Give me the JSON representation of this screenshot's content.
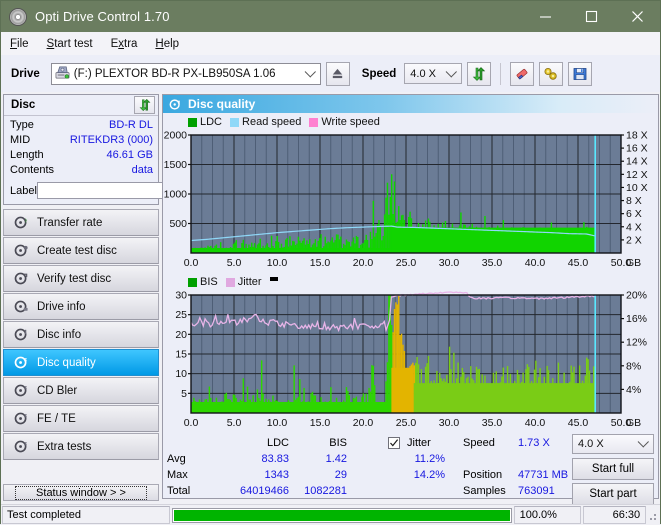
{
  "window": {
    "title": "Opti Drive Control 1.70",
    "icon": "disc-icon",
    "minimize": "minimize",
    "maximize": "maximize",
    "close": "close"
  },
  "menu": [
    {
      "label": "File",
      "accel": "F"
    },
    {
      "label": "Start test",
      "accel": "S"
    },
    {
      "label": "Extra",
      "accel": "x"
    },
    {
      "label": "Help",
      "accel": "H"
    }
  ],
  "toolbar": {
    "drive_label": "Drive",
    "drive_value": "(F:)  PLEXTOR BD-R  PX-LB950SA 1.06",
    "eject_icon": "eject-icon",
    "speed_label": "Speed",
    "speed_value": "4.0 X",
    "refresh_icon": "refresh-icon",
    "erase_icon": "eraser-icon",
    "settings_icon": "tools-icon",
    "save_icon": "floppy-save-icon"
  },
  "disc_panel": {
    "title": "Disc",
    "refresh_icon": "refresh-icon",
    "rows": [
      {
        "key": "Type",
        "value": "BD-R DL"
      },
      {
        "key": "MID",
        "value": "RITEKDR3 (000)"
      },
      {
        "key": "Length",
        "value": "46.61 GB"
      },
      {
        "key": "Contents",
        "value": "data"
      }
    ],
    "label_key": "Label",
    "label_value": "",
    "label_placeholder": "",
    "label_button_icon": "cd-icon"
  },
  "nav": [
    {
      "label": "Transfer rate",
      "icon": "disc-speed-icon",
      "selected": false
    },
    {
      "label": "Create test disc",
      "icon": "disc-write-icon",
      "selected": false
    },
    {
      "label": "Verify test disc",
      "icon": "disc-verify-icon",
      "selected": false
    },
    {
      "label": "Drive info",
      "icon": "drive-info-icon",
      "selected": false
    },
    {
      "label": "Disc info",
      "icon": "disc-info-icon",
      "selected": false
    },
    {
      "label": "Disc quality",
      "icon": "disc-quality-icon",
      "selected": true
    },
    {
      "label": "CD Bler",
      "icon": "cd-bler-icon",
      "selected": false
    },
    {
      "label": "FE / TE",
      "icon": "fete-icon",
      "selected": false
    },
    {
      "label": "Extra tests",
      "icon": "extra-tests-icon",
      "selected": false
    }
  ],
  "status_window_button": "Status window > >",
  "panel": {
    "title": "Disc quality",
    "icon": "disc-quality-icon"
  },
  "chart_data": [
    {
      "type": "area",
      "title": "LDC / Read speed",
      "legend": [
        {
          "label": "LDC",
          "color": "#00A000"
        },
        {
          "label": "Read speed",
          "color": "#8FD8F8"
        },
        {
          "label": "Write speed",
          "color": "#FF80D0"
        }
      ],
      "legend_position": "top-left",
      "xlabel": "GB",
      "xlim": [
        0,
        50
      ],
      "xticks": [
        "0.0",
        "5.0",
        "10.0",
        "15.0",
        "20.0",
        "25.0",
        "30.0",
        "35.0",
        "40.0",
        "45.0",
        "50.0"
      ],
      "ylabel_left": "LDC",
      "ylim": [
        0,
        2000
      ],
      "yticks": [
        "500",
        "1000",
        "1500",
        "2000"
      ],
      "ylabel_right": "Speed",
      "ylim_right": [
        0,
        18
      ],
      "yticks_right": [
        "2 X",
        "4 X",
        "6 X",
        "8 X",
        "10 X",
        "12 X",
        "14 X",
        "16 X",
        "18 X"
      ],
      "grid": true,
      "plot_bg": "#6B7C96",
      "series": [
        {
          "name": "LDC",
          "color": "#00D000",
          "x": [
            0.0,
            0.5,
            1.0,
            1.5,
            2.0,
            2.5,
            3.0,
            3.5,
            4.0,
            4.5,
            5.0,
            5.5,
            6.0,
            6.5,
            7.0,
            7.5,
            8.0,
            8.5,
            9.0,
            9.5,
            10.0,
            10.5,
            11.0,
            11.5,
            12.0,
            12.5,
            13.0,
            13.5,
            14.0,
            14.5,
            15.0,
            15.5,
            16.0,
            16.5,
            17.0,
            17.5,
            18.0,
            18.5,
            19.0,
            19.5,
            20.0,
            20.5,
            21.0,
            21.5,
            22.0,
            22.5,
            23.0,
            23.2,
            23.4,
            23.6,
            23.8,
            24.0,
            24.2,
            24.4,
            24.6,
            24.8,
            25.0,
            25.2,
            25.5,
            26.0,
            26.5,
            27.0,
            27.5,
            28.0,
            28.5,
            29.0,
            29.5,
            30.0,
            30.5,
            31.0,
            31.5,
            32.0,
            32.5,
            33.0,
            33.5,
            34.0,
            34.5,
            35.0,
            35.5,
            36.0,
            36.5,
            37.0,
            37.5,
            38.0,
            38.5,
            39.0,
            39.5,
            40.0,
            40.5,
            41.0,
            41.5,
            42.0,
            42.5,
            43.0,
            43.5,
            44.0,
            44.5,
            45.0,
            45.5,
            46.0,
            46.5,
            47.0
          ],
          "y": [
            60,
            70,
            90,
            60,
            110,
            70,
            120,
            80,
            140,
            75,
            130,
            65,
            150,
            80,
            160,
            90,
            200,
            100,
            185,
            95,
            210,
            110,
            190,
            120,
            230,
            130,
            215,
            140,
            250,
            135,
            240,
            150,
            260,
            145,
            255,
            160,
            245,
            155,
            280,
            165,
            300,
            175,
            320,
            340,
            420,
            600,
            1343,
            980,
            900,
            1100,
            760,
            880,
            700,
            1060,
            620,
            540,
            500,
            470,
            430,
            410,
            395,
            380,
            420,
            360,
            390,
            350,
            370,
            345,
            360,
            330,
            355,
            325,
            350,
            320,
            345,
            315,
            340,
            310,
            335,
            305,
            330,
            300,
            325,
            295,
            320,
            290,
            315,
            285,
            310,
            280,
            305,
            275,
            300,
            270,
            295,
            265,
            290,
            260,
            285,
            255
          ]
        },
        {
          "name": "Read speed",
          "color": "#8FD8F8",
          "x": [
            0.0,
            2.0,
            4.0,
            6.0,
            8.0,
            10.0,
            12.0,
            14.0,
            16.0,
            18.0,
            20.0,
            22.0,
            23.3,
            24.0,
            26.0,
            28.0,
            30.0,
            32.0,
            34.0,
            36.0,
            38.0,
            40.0,
            42.0,
            44.0,
            46.0,
            47.0
          ],
          "y": [
            1.9,
            2.1,
            2.35,
            2.6,
            2.85,
            3.1,
            3.3,
            3.5,
            3.7,
            3.85,
            3.95,
            4.05,
            4.1,
            3.95,
            3.9,
            3.8,
            3.7,
            3.6,
            3.5,
            3.4,
            3.3,
            3.2,
            3.1,
            2.95,
            2.9,
            2.6
          ]
        }
      ],
      "cursor_x": 47.0,
      "cursor_color": "#59E8FF"
    },
    {
      "type": "area",
      "title": "BIS / Jitter",
      "legend": [
        {
          "label": "BIS",
          "color": "#00A000"
        },
        {
          "label": "Jitter",
          "color": "#E0A8E0"
        },
        {
          "label": "",
          "color": "#000000"
        }
      ],
      "legend_position": "top-left",
      "xlabel": "GB",
      "xlim": [
        0,
        50
      ],
      "xticks": [
        "0.0",
        "5.0",
        "10.0",
        "15.0",
        "20.0",
        "25.0",
        "30.0",
        "35.0",
        "40.0",
        "45.0",
        "50.0"
      ],
      "ylabel_left": "BIS",
      "ylim": [
        0,
        30
      ],
      "yticks": [
        "5",
        "10",
        "15",
        "20",
        "25",
        "30"
      ],
      "ylabel_right": "Jitter",
      "ylim_right": [
        0,
        20
      ],
      "yticks_right": [
        "4%",
        "8%",
        "12%",
        "16%",
        "20%"
      ],
      "grid": true,
      "plot_bg": "#6B7C96",
      "series": [
        {
          "name": "BIS",
          "color": "#44D000",
          "x": [
            0.0,
            0.5,
            1.0,
            1.5,
            2.0,
            2.5,
            3.0,
            3.5,
            4.0,
            4.5,
            5.0,
            5.5,
            6.0,
            6.5,
            7.0,
            7.5,
            8.0,
            8.5,
            9.0,
            9.5,
            10.0,
            10.5,
            11.0,
            11.5,
            12.0,
            12.5,
            13.0,
            13.5,
            14.0,
            14.5,
            15.0,
            15.5,
            16.0,
            16.5,
            17.0,
            17.5,
            18.0,
            18.5,
            19.0,
            19.5,
            20.0,
            20.5,
            21.0,
            21.5,
            22.0,
            22.5,
            23.0,
            23.3,
            23.6,
            24.0,
            24.4,
            24.8,
            25.2,
            25.6,
            26.0,
            26.5,
            27.0,
            27.5,
            28.0,
            28.5,
            29.0,
            29.5,
            30.0,
            30.5,
            31.0,
            31.5,
            32.0,
            32.5,
            33.0,
            33.5,
            34.0,
            34.5,
            35.0,
            35.5,
            36.0,
            36.5,
            37.0,
            37.5,
            38.0,
            38.5,
            39.0,
            39.5,
            40.0,
            40.5,
            41.0,
            41.5,
            42.0,
            42.5,
            43.0,
            43.5,
            44.0,
            44.5,
            45.0,
            45.5,
            46.0,
            46.5,
            47.0
          ],
          "y": [
            2.0,
            4.5,
            2.2,
            3.0,
            5.0,
            2.4,
            3.5,
            2.0,
            4.0,
            2.6,
            5.5,
            2.2,
            3.0,
            2.4,
            4.0,
            2.2,
            6.0,
            2.5,
            3.2,
            2.4,
            5.0,
            2.6,
            3.4,
            2.2,
            6.5,
            2.8,
            3.0,
            2.4,
            5.2,
            2.6,
            3.4,
            2.2,
            4.8,
            2.4,
            3.0,
            2.6,
            5.6,
            2.2,
            3.2,
            2.4,
            5.0,
            2.6,
            11.0,
            2.8,
            3.4,
            2.6,
            29.0,
            26.0,
            22.0,
            24.0,
            19.0,
            14.0,
            12.0,
            11.5,
            10.5,
            11.0,
            9.5,
            10.5,
            9.0,
            10.0,
            9.5,
            9.0,
            10.5,
            9.0,
            9.5,
            8.8,
            10.0,
            9.2,
            9.0,
            8.6,
            10.2,
            8.8,
            9.4,
            8.6,
            9.0,
            8.8,
            9.6,
            8.4,
            9.0,
            8.6,
            9.2,
            8.4,
            10.0,
            8.6,
            9.2,
            8.4,
            9.6,
            8.6,
            9.0,
            8.4,
            9.8,
            8.6,
            9.2,
            8.8,
            10.6,
            9.0,
            8.5
          ]
        },
        {
          "name": "Jitter",
          "color": "#E8B4E8",
          "x": [
            0.0,
            1.0,
            2.0,
            3.0,
            4.0,
            5.0,
            6.0,
            7.0,
            7.5,
            8.0,
            9.0,
            10.0,
            11.0,
            12.0,
            13.0,
            14.0,
            15.0,
            16.0,
            17.0,
            18.0,
            19.0,
            20.0,
            21.0,
            22.0,
            23.0,
            23.3,
            24.0,
            25.0,
            26.0,
            27.0,
            28.0,
            29.0,
            30.0,
            31.0,
            32.0,
            32.5,
            33.0,
            34.0,
            35.0,
            36.0,
            38.0,
            40.0,
            42.0,
            44.0,
            46.0,
            47.0
          ],
          "y": [
            15.0,
            15.2,
            15.0,
            15.3,
            15.1,
            15.4,
            15.6,
            16.2,
            16.5,
            15.8,
            15.4,
            15.3,
            15.0,
            14.9,
            14.7,
            14.6,
            14.5,
            14.6,
            14.5,
            14.6,
            14.7,
            14.6,
            14.5,
            14.6,
            14.5,
            19.8,
            19.9,
            20.0,
            20.1,
            20.2,
            20.3,
            20.4,
            20.5,
            20.4,
            20.5,
            19.5,
            19.4,
            19.5,
            19.4,
            19.5,
            19.5,
            19.4,
            19.5,
            19.6,
            19.8,
            19.8
          ]
        }
      ],
      "cursor_x": 47.0,
      "cursor_color": "#59E8FF"
    }
  ],
  "stats": {
    "col_ldc": "LDC",
    "col_bis": "BIS",
    "jitter_label": "Jitter",
    "jitter_checked": true,
    "rows": [
      {
        "label": "Avg",
        "ldc": "83.83",
        "bis": "1.42",
        "jitter": "11.2%"
      },
      {
        "label": "Max",
        "ldc": "1343",
        "bis": "29",
        "jitter": "14.2%"
      },
      {
        "label": "Total",
        "ldc": "64019466",
        "bis": "1082281",
        "jitter": ""
      }
    ],
    "speed_label": "Speed",
    "speed_value": "1.73 X",
    "position_label": "Position",
    "position_value": "47731 MB",
    "samples_label": "Samples",
    "samples_value": "763091",
    "speed_select": "4.0 X",
    "start_full": "Start full",
    "start_part": "Start part"
  },
  "statusbar": {
    "message": "Test completed",
    "progress_percent": 100.0,
    "progress_text": "100.0%",
    "elapsed": "66:30",
    "progress_color": "#00B400"
  }
}
